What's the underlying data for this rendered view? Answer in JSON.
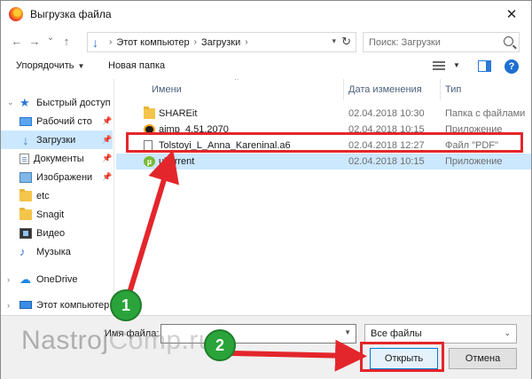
{
  "window": {
    "title": "Выгрузка файла",
    "close_glyph": "✕"
  },
  "nav": {
    "back_glyph": "←",
    "forward_glyph": "→",
    "dropdown_glyph": "⌄",
    "up_glyph": "↑",
    "breadcrumb": [
      "Этот компьютер",
      "Загрузки"
    ],
    "search_placeholder": "Поиск: Загрузки"
  },
  "toolbar": {
    "organize_label": "Упорядочить",
    "new_folder_label": "Новая папка",
    "help_glyph": "?"
  },
  "sidebar": {
    "items": [
      {
        "label": "Быстрый доступ",
        "icon": "star-icon"
      },
      {
        "label": "Рабочий сто",
        "icon": "desktop-icon"
      },
      {
        "label": "Загрузки",
        "icon": "download-icon"
      },
      {
        "label": "Документы",
        "icon": "documents-icon"
      },
      {
        "label": "Изображени",
        "icon": "pictures-icon"
      },
      {
        "label": "etc",
        "icon": "folder-icon"
      },
      {
        "label": "Snagit",
        "icon": "folder-icon"
      },
      {
        "label": "Видео",
        "icon": "video-icon"
      },
      {
        "label": "Музыка",
        "icon": "music-icon"
      },
      {
        "label": "OneDrive",
        "icon": "cloud-icon"
      },
      {
        "label": "Этот компьютер",
        "icon": "computer-icon"
      }
    ]
  },
  "filelist": {
    "columns": [
      "Имени",
      "Дата изменения",
      "Тип"
    ],
    "rows": [
      {
        "name": "SHAREit",
        "date": "02.04.2018 10:30",
        "type": "Папка с файлами",
        "icon": "folder-icon"
      },
      {
        "name": "aimp_4.51.2070",
        "date": "02.04.2018 10:15",
        "type": "Приложение",
        "icon": "aimp-icon"
      },
      {
        "name": "Tolstoyi_L_Anna_Kareninal.a6",
        "date": "02.04.2018 12:27",
        "type": "Файл \"PDF\"",
        "icon": "pdf-file-icon"
      },
      {
        "name": "uTorrent",
        "date": "02.04.2018 10:15",
        "type": "Приложение",
        "icon": "utorrent-icon"
      }
    ]
  },
  "bottom": {
    "filename_label": "Имя файла:",
    "filename_value": "",
    "filter_value": "Все файлы",
    "open_label": "Открыть",
    "cancel_label": "Отмена"
  },
  "annotations": {
    "step1": "1",
    "step2": "2",
    "accent_red": "#e3262b",
    "badge_green": "#2aa43a"
  },
  "watermark": {
    "part1": "Nastroj",
    "part2": "Comp.ru"
  }
}
